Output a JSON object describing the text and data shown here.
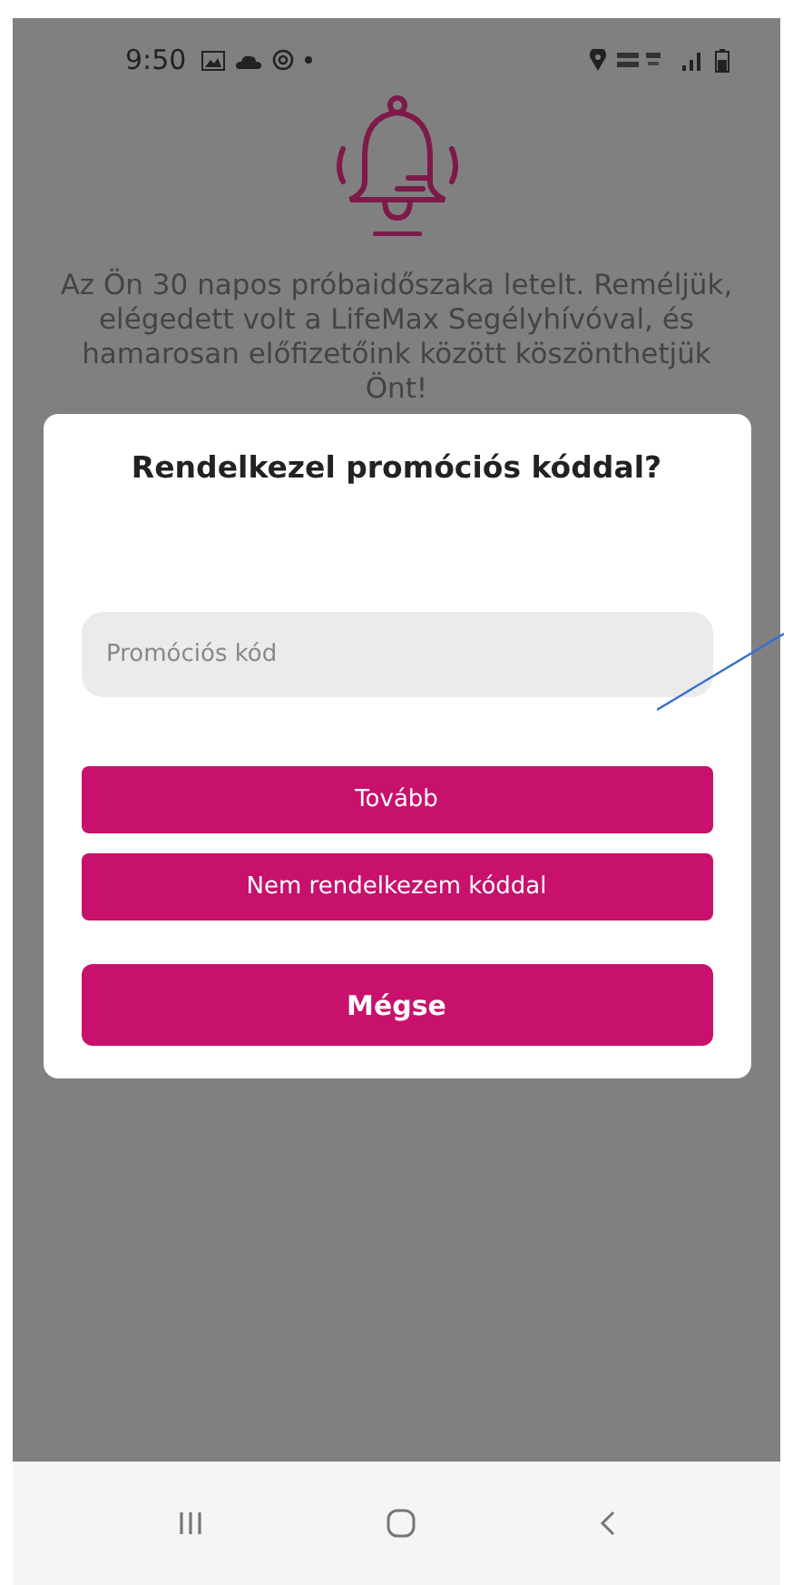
{
  "status_bar": {
    "time": "9:50"
  },
  "message": "Az Ön 30 napos próbaidőszaka letelt. Reméljük, elégedett volt a LifeMax Segélyhívóval, és hamarosan előfizetőink között köszönthetjük Önt!",
  "dialog": {
    "title": "Rendelkezel promóciós kóddal?",
    "field": {
      "placeholder": "Promóciós kód"
    },
    "buttons": [
      {
        "label": "Tovább",
        "kind": "normal"
      },
      {
        "label": "Nem rendelkezem kóddal",
        "kind": "normal"
      },
      {
        "label": "Mégse",
        "kind": "large"
      }
    ]
  }
}
